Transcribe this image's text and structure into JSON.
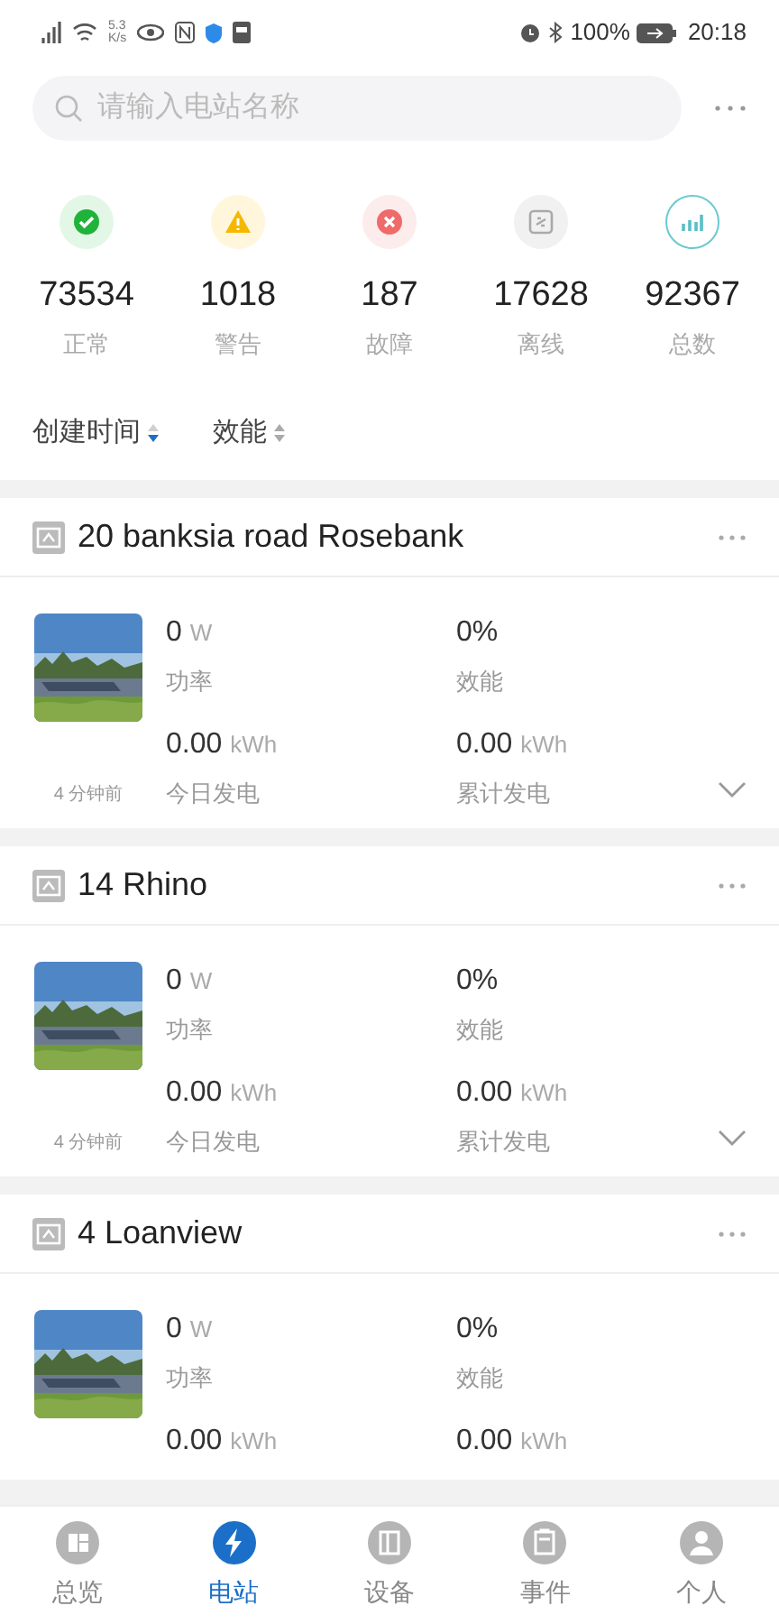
{
  "status_bar": {
    "speed": "5.3",
    "speed_unit": "K/s",
    "battery": "100%",
    "time": "20:18"
  },
  "search": {
    "placeholder": "请输入电站名称"
  },
  "stats": [
    {
      "kind": "normal",
      "value": "73534",
      "label": "正常"
    },
    {
      "kind": "warning",
      "value": "1018",
      "label": "警告"
    },
    {
      "kind": "fault",
      "value": "187",
      "label": "故障"
    },
    {
      "kind": "offline",
      "value": "17628",
      "label": "离线"
    },
    {
      "kind": "total",
      "value": "92367",
      "label": "总数"
    }
  ],
  "sort": [
    {
      "label": "创建时间",
      "selected": true
    },
    {
      "label": "效能",
      "selected": false
    }
  ],
  "stations": [
    {
      "name": "20 banksia road Rosebank",
      "power": "0",
      "power_unit": "W",
      "power_label": "功率",
      "efficiency": "0%",
      "efficiency_label": "效能",
      "today": "0.00",
      "today_unit": "kWh",
      "today_label": "今日发电",
      "total": "0.00",
      "total_unit": "kWh",
      "total_label": "累计发电",
      "updated": "4 分钟前"
    },
    {
      "name": "14 Rhino",
      "power": "0",
      "power_unit": "W",
      "power_label": "功率",
      "efficiency": "0%",
      "efficiency_label": "效能",
      "today": "0.00",
      "today_unit": "kWh",
      "today_label": "今日发电",
      "total": "0.00",
      "total_unit": "kWh",
      "total_label": "累计发电",
      "updated": "4 分钟前"
    },
    {
      "name": "4 Loanview",
      "power": "0",
      "power_unit": "W",
      "power_label": "功率",
      "efficiency": "0%",
      "efficiency_label": "效能",
      "today": "0.00",
      "today_unit": "kWh",
      "total": "0.00",
      "total_unit": "kWh"
    }
  ],
  "nav": [
    {
      "kind": "overview",
      "label": "总览",
      "selected": false
    },
    {
      "kind": "station",
      "label": "电站",
      "selected": true
    },
    {
      "kind": "device",
      "label": "设备",
      "selected": false
    },
    {
      "kind": "event",
      "label": "事件",
      "selected": false
    },
    {
      "kind": "user",
      "label": "个人",
      "selected": false
    }
  ]
}
